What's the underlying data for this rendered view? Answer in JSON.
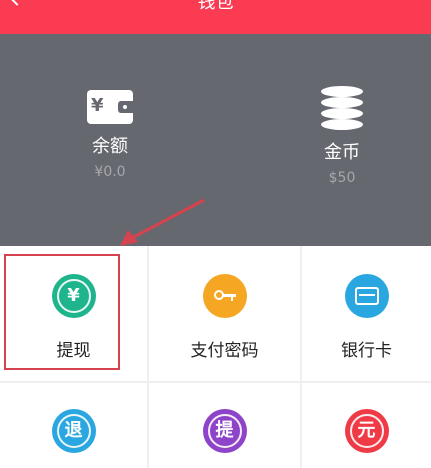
{
  "header": {
    "title": "钱包"
  },
  "summary": {
    "balance": {
      "label": "余额",
      "value": "¥0.0",
      "icon": "wallet-icon"
    },
    "coins": {
      "label": "金币",
      "value": "$50",
      "icon": "coins-stack-icon"
    }
  },
  "grid": {
    "items": [
      {
        "label": "提现",
        "icon": "yen-circle-icon",
        "glyph": "¥",
        "color": "#1fb58c"
      },
      {
        "label": "支付密码",
        "icon": "key-icon",
        "color": "#f5a623"
      },
      {
        "label": "银行卡",
        "icon": "bank-card-icon",
        "color": "#2aa7e0"
      },
      {
        "label": "",
        "icon": "refund-icon",
        "glyph": "退",
        "color": "#2aa7e0"
      },
      {
        "label": "",
        "icon": "withdraw-record-icon",
        "glyph": "提",
        "color": "#8e44c9"
      },
      {
        "label": "",
        "icon": "yuan-icon",
        "glyph": "元",
        "color": "#ef3b46"
      }
    ]
  },
  "colors": {
    "header": "#fb3b52",
    "summary_bg": "#66686f",
    "highlight": "#d6434e"
  }
}
